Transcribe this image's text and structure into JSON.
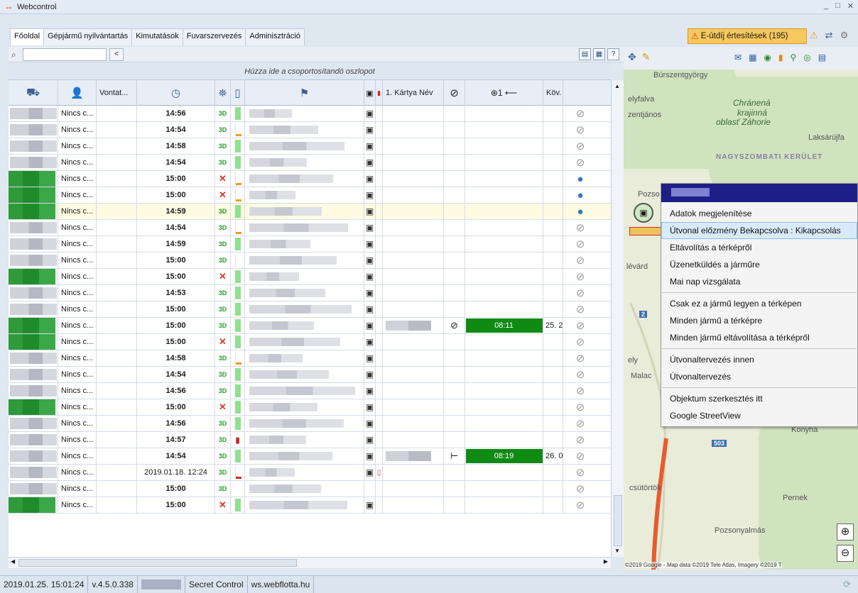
{
  "app": {
    "title": "Webcontrol"
  },
  "tabs": [
    "Főoldal",
    "Gépjármű nyilvántartás",
    "Kimutatások",
    "Fuvarszervezés",
    "Adminisztráció"
  ],
  "alerts": {
    "label": "E-útdíj értesítések (195)"
  },
  "toolbar": {
    "search_value": "",
    "collapse_label": "<"
  },
  "grid": {
    "group_hint": "Húzza ide a csoportosítandó oszlopot",
    "headers": {
      "vontato": "Vontat...",
      "card_name": "1. Kártya Név",
      "kov": "Köv."
    },
    "rows": [
      {
        "green": false,
        "driver": "Nincs c...",
        "time": "14:56",
        "gps": "3D",
        "bat": "green",
        "drive": "",
        "kov": "",
        "tacho": "",
        "globe": false
      },
      {
        "green": false,
        "driver": "Nincs c...",
        "time": "14:54",
        "gps": "3D",
        "bat": "white-orange",
        "drive": "",
        "kov": "",
        "tacho": "",
        "globe": false
      },
      {
        "green": false,
        "driver": "Nincs c...",
        "time": "14:58",
        "gps": "3D",
        "bat": "green",
        "drive": "",
        "kov": "",
        "tacho": "",
        "globe": false
      },
      {
        "green": false,
        "driver": "Nincs c...",
        "time": "14:54",
        "gps": "3D",
        "bat": "green",
        "drive": "",
        "kov": "",
        "tacho": "",
        "globe": false
      },
      {
        "green": true,
        "driver": "Nincs c...",
        "time": "15:00",
        "gps": "x",
        "bat": "white-orange",
        "drive": "",
        "kov": "",
        "tacho": "",
        "globe": true
      },
      {
        "green": true,
        "driver": "Nincs c...",
        "time": "15:00",
        "gps": "x",
        "bat": "white-orange",
        "drive": "",
        "kov": "",
        "tacho": "",
        "globe": true
      },
      {
        "green": true,
        "driver": "Nincs c...",
        "time": "14:59",
        "gps": "3D",
        "bat": "green",
        "drive": "",
        "kov": "",
        "tacho": "",
        "globe": true,
        "selected": true
      },
      {
        "green": false,
        "driver": "Nincs c...",
        "time": "14:54",
        "gps": "3D",
        "bat": "white-orange",
        "drive": "",
        "kov": "",
        "tacho": "",
        "globe": false
      },
      {
        "green": false,
        "driver": "Nincs c...",
        "time": "14:59",
        "gps": "3D",
        "bat": "green",
        "drive": "",
        "kov": "",
        "tacho": "",
        "globe": false
      },
      {
        "green": false,
        "driver": "Nincs c...",
        "time": "15:00",
        "gps": "3D",
        "bat": "white",
        "drive": "",
        "kov": "",
        "tacho": "",
        "globe": false
      },
      {
        "green": true,
        "driver": "Nincs c...",
        "time": "15:00",
        "gps": "x",
        "bat": "green",
        "drive": "",
        "kov": "",
        "tacho": "",
        "globe": false
      },
      {
        "green": false,
        "driver": "Nincs c...",
        "time": "14:53",
        "gps": "3D",
        "bat": "green",
        "drive": "",
        "kov": "",
        "tacho": "",
        "globe": false
      },
      {
        "green": false,
        "driver": "Nincs c...",
        "time": "15:00",
        "gps": "3D",
        "bat": "green",
        "drive": "",
        "kov": "",
        "tacho": "",
        "globe": false
      },
      {
        "green": true,
        "driver": "Nincs c...",
        "time": "15:00",
        "gps": "3D",
        "bat": "green",
        "drive": "08:11",
        "kov": "25. 2",
        "tacho": "⊘",
        "card": true,
        "globe": false
      },
      {
        "green": true,
        "driver": "Nincs c...",
        "time": "15:00",
        "gps": "x",
        "bat": "green",
        "drive": "",
        "kov": "",
        "tacho": "",
        "globe": false
      },
      {
        "green": false,
        "driver": "Nincs c...",
        "time": "14:58",
        "gps": "3D",
        "bat": "white-orange",
        "drive": "",
        "kov": "",
        "tacho": "",
        "globe": false
      },
      {
        "green": false,
        "driver": "Nincs c...",
        "time": "14:54",
        "gps": "3D",
        "bat": "green",
        "drive": "",
        "kov": "",
        "tacho": "",
        "globe": false
      },
      {
        "green": false,
        "driver": "Nincs c...",
        "time": "14:56",
        "gps": "3D",
        "bat": "green",
        "drive": "",
        "kov": "",
        "tacho": "",
        "globe": false
      },
      {
        "green": true,
        "driver": "Nincs c...",
        "time": "15:00",
        "gps": "x",
        "bat": "green",
        "drive": "",
        "kov": "",
        "tacho": "",
        "globe": false
      },
      {
        "green": false,
        "driver": "Nincs c...",
        "time": "14:56",
        "gps": "3D",
        "bat": "green",
        "drive": "",
        "kov": "",
        "tacho": "",
        "globe": false
      },
      {
        "green": false,
        "driver": "Nincs c...",
        "time": "14:57",
        "gps": "3D",
        "bat": "red-icon",
        "drive": "",
        "kov": "",
        "tacho": "",
        "globe": false
      },
      {
        "green": false,
        "driver": "Nincs c...",
        "time": "14:54",
        "gps": "3D",
        "bat": "green",
        "drive": "08:19",
        "kov": "26. 0",
        "tacho": "⊢",
        "card": true,
        "globe": false
      },
      {
        "green": false,
        "driver": "Nincs c...",
        "time": "2019.01.18. 12:24",
        "gps": "3D",
        "bat": "white-red",
        "drive": "",
        "kov": "",
        "tacho": "",
        "globe": false,
        "timeNormal": true,
        "fuel": true
      },
      {
        "green": false,
        "driver": "Nincs c...",
        "time": "15:00",
        "gps": "3D",
        "bat": "none",
        "drive": "",
        "kov": "",
        "tacho": "",
        "globe": false,
        "noTruck": true
      },
      {
        "green": true,
        "driver": "Nincs c...",
        "time": "15:00",
        "gps": "x",
        "bat": "green",
        "drive": "",
        "kov": "",
        "tacho": "",
        "globe": false
      }
    ]
  },
  "map": {
    "labels": {
      "burszentgyorgy": "Búrszentgyörgy",
      "elyfalva": "elyfalva",
      "zentjanos": "zentjános",
      "chranena": "Chránená",
      "krajinna": "krajinná",
      "oblast": "oblasť Záhorie",
      "laksarujfalu": "Laksárújfa",
      "nagyszombati": "NAGYSZOMBATI KERÜLET",
      "pozs": "Pozso",
      "levard": "lévárd",
      "ely": "ely",
      "malac": "Malac",
      "konyha": "Konyha",
      "csutortok": "csütörtök",
      "pernek": "Pernek",
      "pozsonyalmas": "Pozsonyalmás",
      "road_2": "2",
      "road_503": "503"
    },
    "attribution": "©2019 Google - Map data ©2019 Tele Atlas, Imagery ©2019 T"
  },
  "context_menu": {
    "items": [
      "Adatok megjelenítése",
      "Útvonal előzmény Bekapcsolva : Kikapcsolás",
      "Eltávolítás a térképről",
      "Üzenetküldés a járműre",
      "Mai nap vizsgálata",
      "Csak ez a jármű legyen a térképen",
      "Minden jármű a térképre",
      "Minden jármű eltávolítása a térképről",
      "Útvonaltervezés innen",
      "Útvonaltervezés",
      "Objektum szerkesztés itt",
      "Google StreetView"
    ]
  },
  "status": {
    "datetime": "2019.01.25. 15:01:24",
    "version": "v.4.5.0.338",
    "product": "Secret Control",
    "site": "ws.webflotta.hu"
  }
}
